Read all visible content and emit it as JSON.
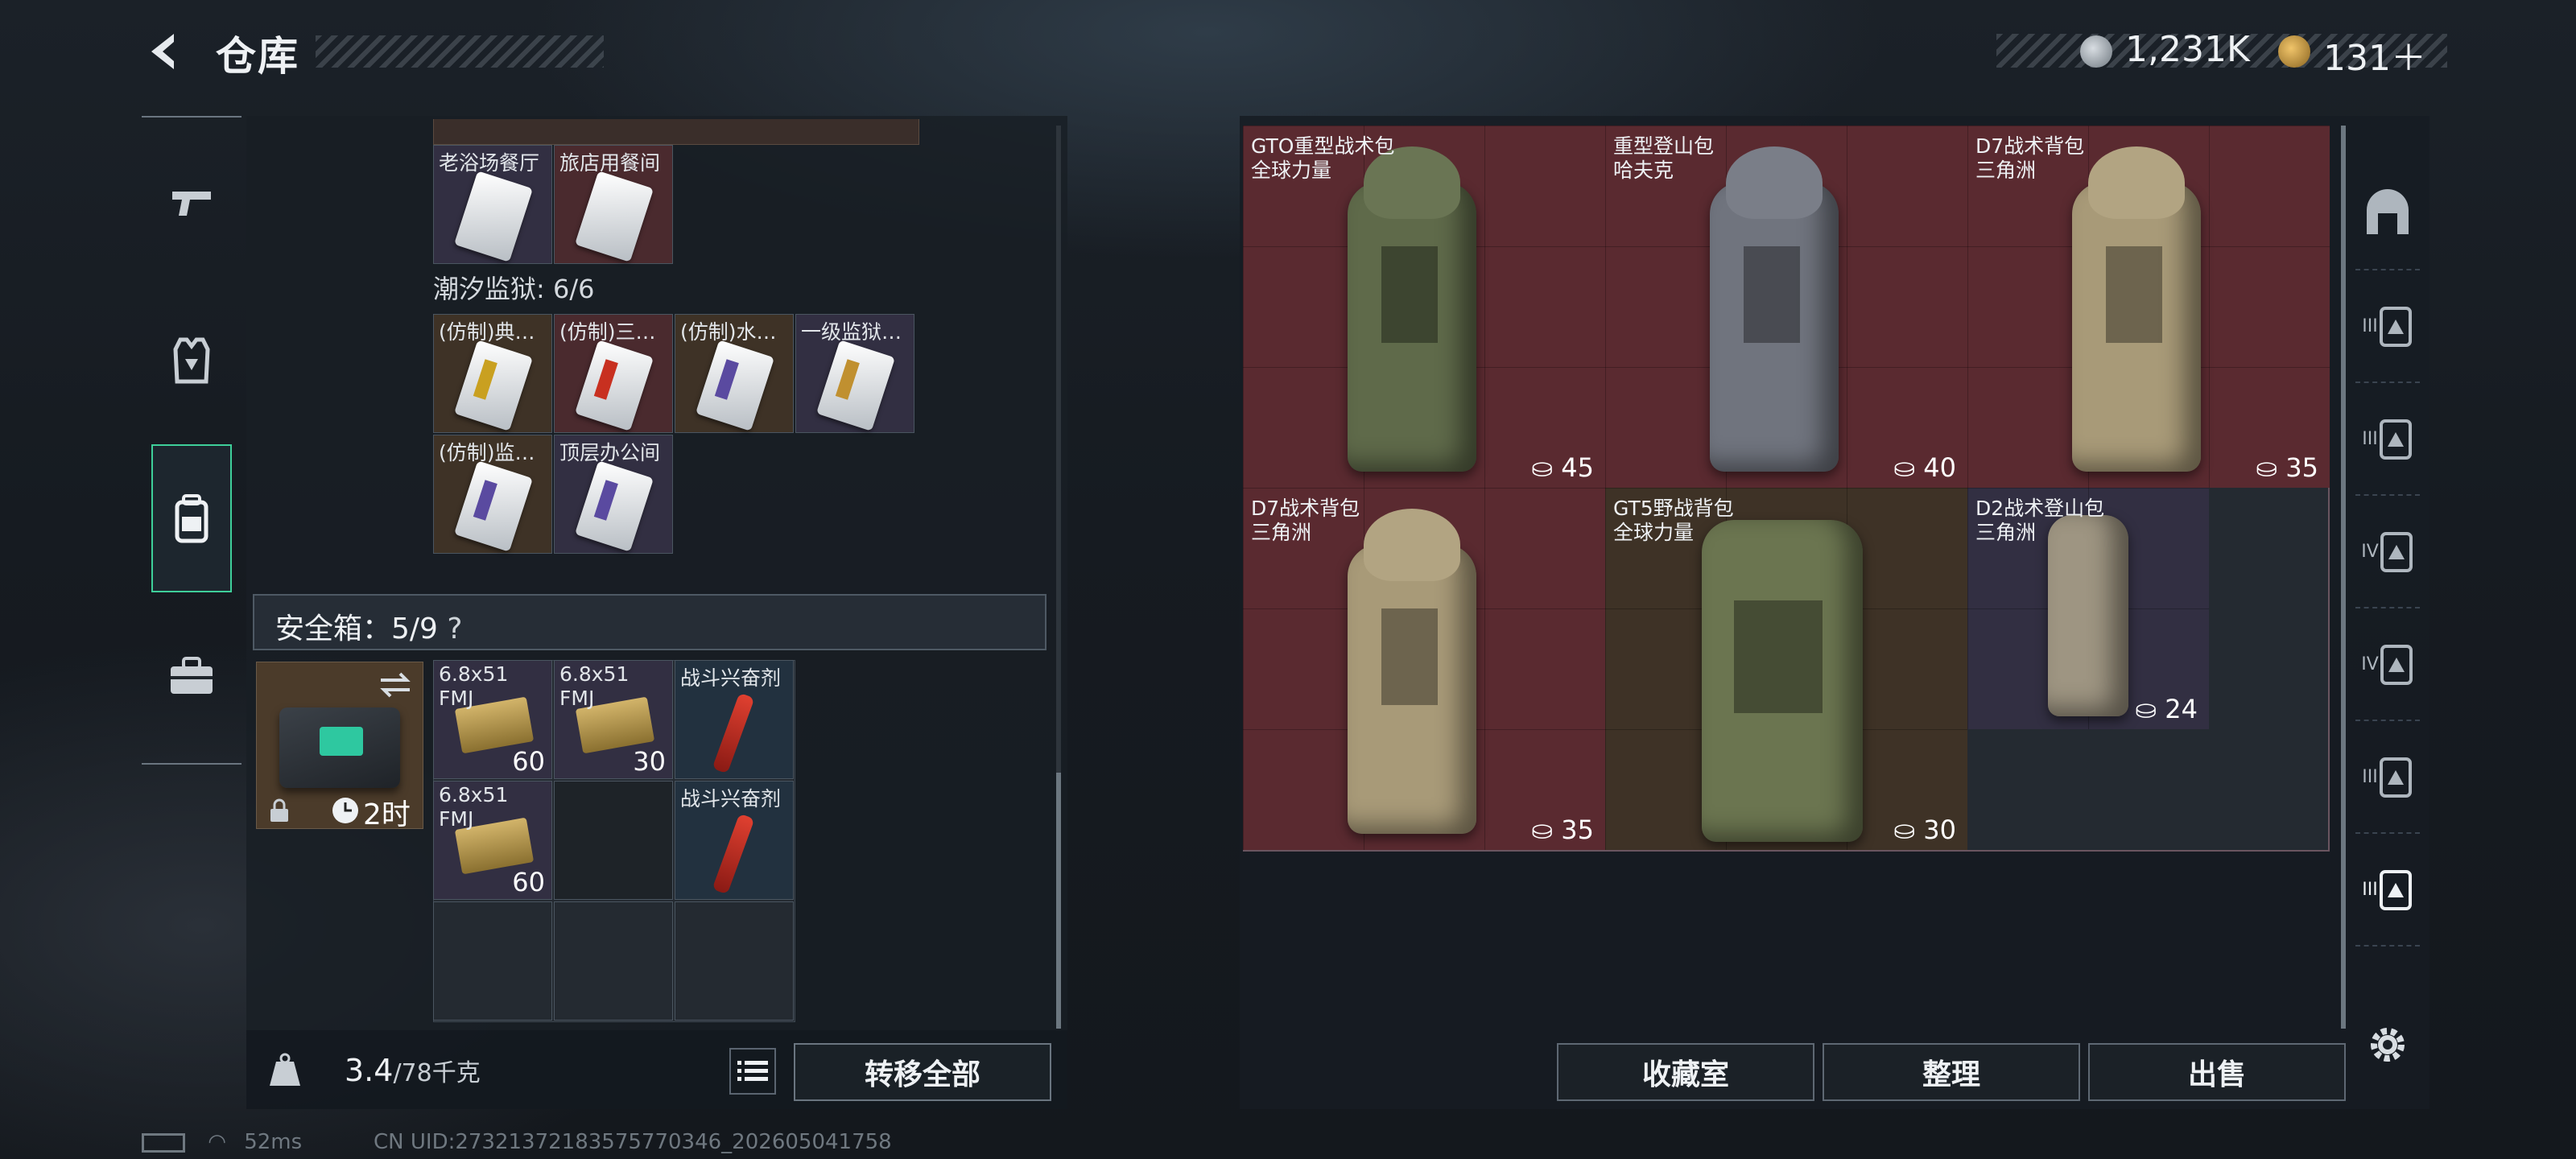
{
  "header": {
    "title": "仓库",
    "back_icon": "chevron-left-icon"
  },
  "currency": {
    "silver": "1,231K",
    "gold": "131＋"
  },
  "left_nav": {
    "items": [
      {
        "icon": "pistol-icon"
      },
      {
        "icon": "vest-icon"
      },
      {
        "icon": "backpack-icon",
        "active": true
      },
      {
        "icon": "briefcase-icon"
      }
    ]
  },
  "stash": {
    "row_top": [
      {
        "label": "老浴场餐厅",
        "bg": "purple"
      },
      {
        "label": "旅店用餐间",
        "bg": "red"
      }
    ],
    "section_title": "潮汐监狱: 6/6",
    "row_a": [
      {
        "label": "(仿制)典…",
        "bg": "brown",
        "accent": "#c9a020"
      },
      {
        "label": "(仿制)三…",
        "bg": "red",
        "accent": "#c83020"
      },
      {
        "label": "(仿制)水…",
        "bg": "brown",
        "accent": "#5a4aa0"
      },
      {
        "label": "一级监狱…",
        "bg": "purple",
        "accent": "#c09030"
      }
    ],
    "row_b": [
      {
        "label": "(仿制)监…",
        "bg": "brown",
        "accent": "#5a4aa0"
      },
      {
        "label": "顶层办公间",
        "bg": "purple",
        "accent": "#5a4aa0"
      }
    ]
  },
  "safebox": {
    "label": "安全箱：5/9",
    "help": "?",
    "timer": "2时",
    "items": [
      {
        "label": "6.8x51 FMJ",
        "qty": "60",
        "type": "ammo"
      },
      {
        "label": "6.8x51 FMJ",
        "qty": "30",
        "type": "ammo"
      },
      {
        "label": "战斗兴奋剂",
        "qty": "",
        "type": "stim"
      },
      {
        "label": "6.8x51 FMJ",
        "qty": "60",
        "type": "ammo"
      },
      {
        "label": "",
        "qty": "",
        "type": "empty"
      },
      {
        "label": "战斗兴奋剂",
        "qty": "",
        "type": "stim"
      }
    ]
  },
  "weight": {
    "current": "3.4",
    "max": "/78千克",
    "icon_label": "KG"
  },
  "buttons": {
    "transfer_all": "转移全部",
    "collection": "收藏室",
    "sort": "整理",
    "sell": "出售"
  },
  "backpacks": [
    {
      "name": "GTO重型战术包",
      "brand": "全球力量",
      "capacity": "45",
      "color": "#5f6a4a",
      "bg": "red"
    },
    {
      "name": "重型登山包",
      "brand": "哈夫克",
      "capacity": "40",
      "color": "#70747e",
      "bg": "red"
    },
    {
      "name": "D7战术背包",
      "brand": "三角洲",
      "capacity": "35",
      "color": "#a89a78",
      "bg": "red"
    },
    {
      "name": "D7战术背包",
      "brand": "三角洲",
      "capacity": "35",
      "color": "#a89a78",
      "bg": "red"
    },
    {
      "name": "GT5野战背包",
      "brand": "全球力量",
      "capacity": "30",
      "color": "#6b7550",
      "bg": "brown"
    },
    {
      "name": "D2战术登山包",
      "brand": "三角洲",
      "capacity": "24",
      "color": "#9e9582",
      "bg": "purple"
    }
  ],
  "right_nav": [
    "shield-icon",
    "III",
    "III",
    "IV",
    "IV",
    "III",
    "III"
  ],
  "footer": {
    "ping": "52ms",
    "uid": "CN UID:27321372183575770346_202605041758"
  }
}
